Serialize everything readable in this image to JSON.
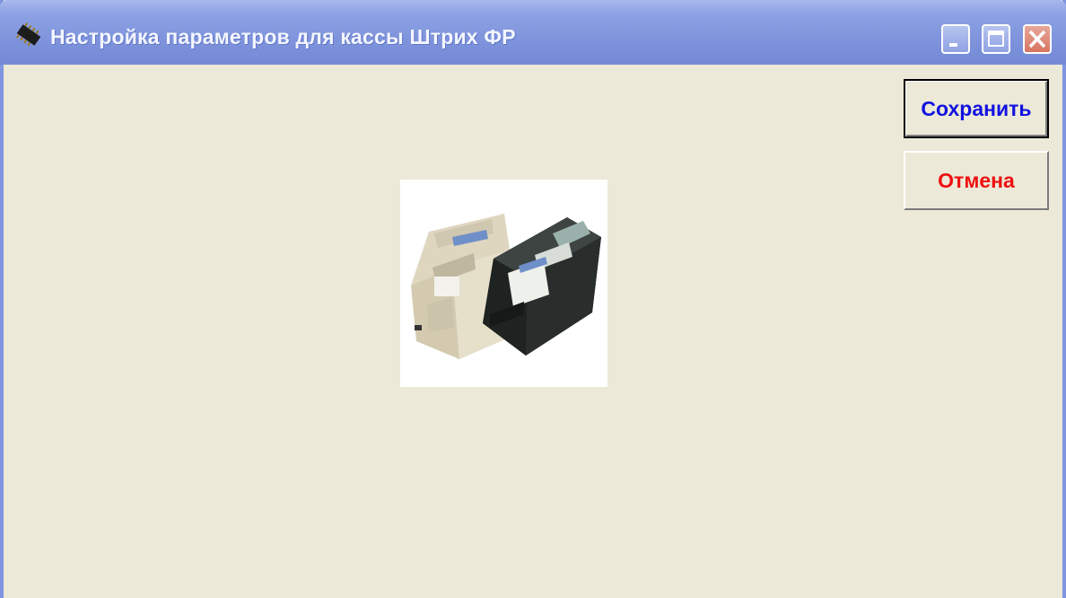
{
  "window": {
    "title": "Настройка параметров для кассы Штрих ФР",
    "icon": "chip-icon",
    "controls": [
      "minimize",
      "maximize",
      "close"
    ]
  },
  "buttons": {
    "save_label": "Сохранить",
    "cancel_label": "Отмена"
  },
  "colors": {
    "titlebar": "#7f94dc",
    "client": "#ece9d8",
    "save_text": "#1212e0",
    "cancel_text": "#ee1010"
  },
  "image": {
    "subject": "fiscal-cash-register-printers-icon"
  }
}
